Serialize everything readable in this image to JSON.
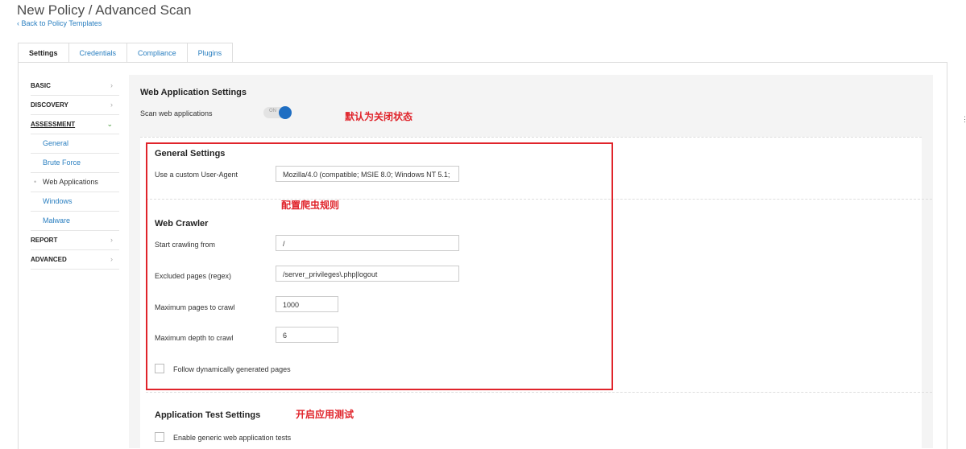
{
  "header": {
    "title": "New Policy / Advanced Scan",
    "back_link": "‹ Back to Policy Templates"
  },
  "tabs": [
    {
      "label": "Settings",
      "active": true
    },
    {
      "label": "Credentials"
    },
    {
      "label": "Compliance"
    },
    {
      "label": "Plugins"
    }
  ],
  "sidebar": {
    "basic": "BASIC",
    "discovery": "DISCOVERY",
    "assessment": "ASSESSMENT",
    "assessment_items": [
      "General",
      "Brute Force",
      "Web Applications",
      "Windows",
      "Malware"
    ],
    "report": "REPORT",
    "advanced": "ADVANCED"
  },
  "main": {
    "title": "Web Application Settings",
    "scan_label": "Scan web applications",
    "toggle_text": "ON",
    "general_title": "General Settings",
    "user_agent_label": "Use a custom User-Agent",
    "user_agent_value": "Mozilla/4.0 (compatible; MSIE 8.0; Windows NT 5.1;",
    "crawler_title": "Web Crawler",
    "start_label": "Start crawling from",
    "start_value": "/",
    "excluded_label": "Excluded pages (regex)",
    "excluded_value": "/server_privileges\\.php|logout",
    "max_pages_label": "Maximum pages to crawl",
    "max_pages_value": "1000",
    "max_depth_label": "Maximum depth to crawl",
    "max_depth_value": "6",
    "follow_label": "Follow dynamically generated pages",
    "app_test_title": "Application Test Settings",
    "generic_label": "Enable generic web application tests"
  },
  "annotations": {
    "default_off": "默认为关闭状态",
    "crawler_rules": "配置爬虫规则",
    "enable_tests": "开启应用测试"
  },
  "colors": {
    "link": "#2a7fc0",
    "toggle": "#1f6ec2",
    "annotation": "#e0242b"
  }
}
